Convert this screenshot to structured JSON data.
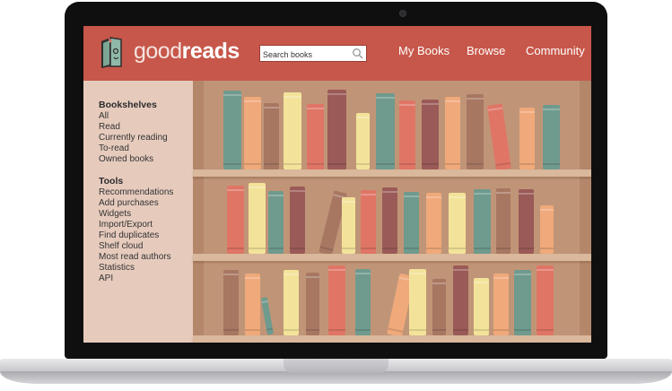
{
  "header": {
    "logo_light": "good",
    "logo_bold": "reads",
    "search_placeholder": "Search books",
    "nav": [
      "My Books",
      "Browse",
      "Community"
    ]
  },
  "sidebar": {
    "bookshelves_title": "Bookshelves",
    "bookshelves": [
      "All",
      "Read",
      "Currently reading",
      "To-read",
      "Owned books"
    ],
    "tools_title": "Tools",
    "tools": [
      "Recommendations",
      "Add purchases",
      "Widgets",
      "Import/Export",
      "Find duplicates",
      "Shelf cloud",
      "Most read authors",
      "Statistics",
      "API"
    ]
  },
  "colors": {
    "header": "#c7574a",
    "sidebar": "#e6cbbd",
    "shelf": "#c09577",
    "book_teal": "#6f9a8e",
    "book_orange": "#f0a97a",
    "book_brown": "#a77762",
    "book_yellow": "#f3e39a",
    "book_red": "#e07566",
    "book_maroon": "#9a5a57"
  }
}
